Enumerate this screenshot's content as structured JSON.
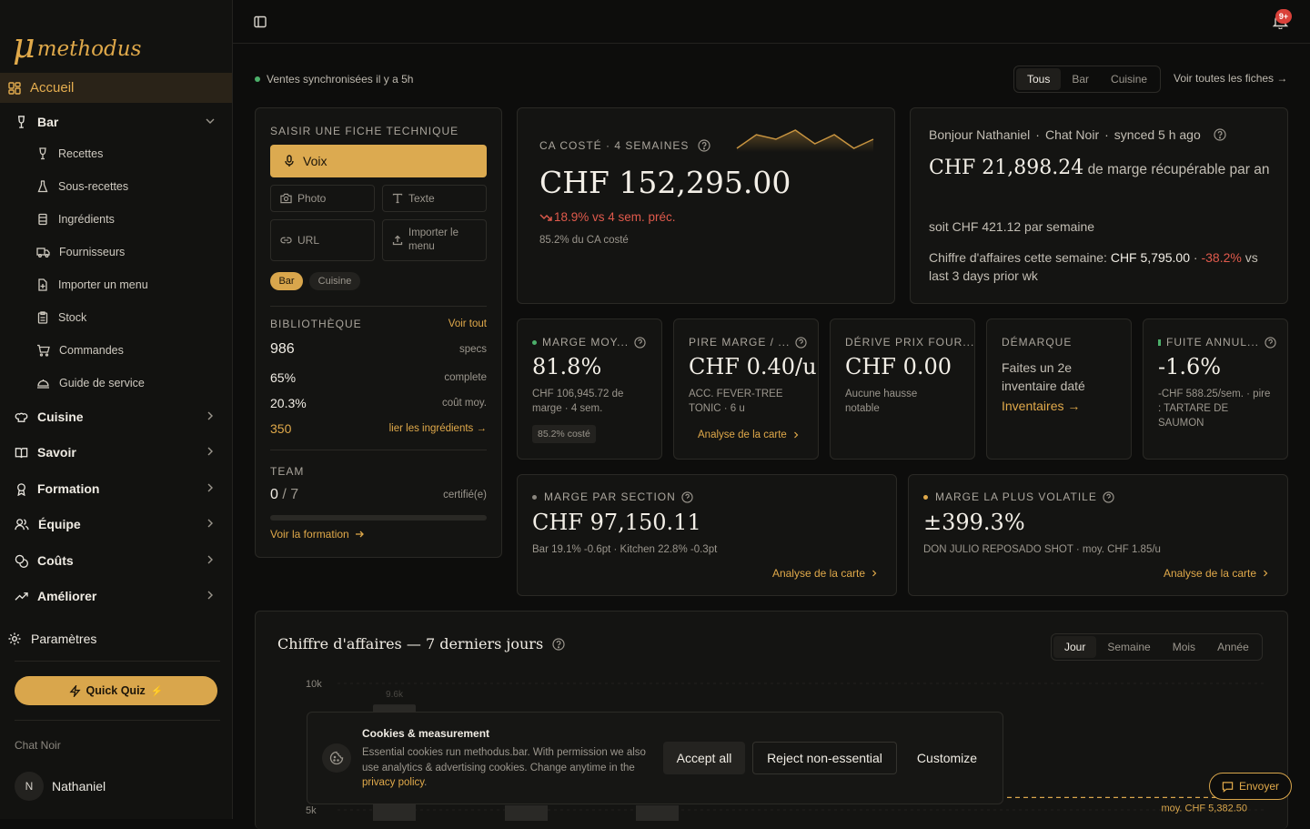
{
  "brand": {
    "mu": "μ",
    "name": "methodus"
  },
  "nav": {
    "home": "Accueil",
    "bar": {
      "label": "Bar",
      "items": [
        "Recettes",
        "Sous-recettes",
        "Ingrédients",
        "Fournisseurs",
        "Importer un menu",
        "Stock",
        "Commandes",
        "Guide de service"
      ]
    },
    "sections": [
      "Cuisine",
      "Savoir",
      "Formation",
      "Équipe",
      "Coûts",
      "Améliorer"
    ],
    "settings": "Paramètres"
  },
  "quiz": {
    "label": "Quick Quiz",
    "emoji": "⚡"
  },
  "org": "Chat Noir",
  "user": {
    "initial": "N",
    "name": "Nathaniel"
  },
  "notifications": {
    "badge": "9+"
  },
  "header": {
    "sync": "Ventes synchronisées il y a 5h",
    "filters": [
      "Tous",
      "Bar",
      "Cuisine"
    ],
    "selected_filter": "Tous",
    "all_sheets": "Voir toutes les fiches →"
  },
  "entry": {
    "title": "SAISIR UNE FICHE TECHNIQUE",
    "voice": "Voix",
    "photo": "Photo",
    "text": "Texte",
    "url": "URL",
    "import": "Importer le menu",
    "tags": [
      "Bar",
      "Cuisine"
    ],
    "library": {
      "title": "BIBLIOTHÈQUE",
      "see_all": "Voir tout",
      "rows": [
        {
          "v": "986",
          "l": "specs"
        },
        {
          "v": "65%",
          "l": "complete"
        },
        {
          "v": "20.3%",
          "l": "coût moy."
        },
        {
          "v": "350",
          "l": "lier les ingrédients →"
        }
      ]
    },
    "team": {
      "title": "TEAM",
      "done": "0",
      "sep": "/",
      "total": "7",
      "label": "certifié(e)",
      "progress": 0,
      "link": "Voir la formation"
    }
  },
  "ca": {
    "label": "CA COSTÉ · 4 SEMAINES",
    "value": "CHF 152,295.00",
    "delta": "18.9% vs 4 sem. préc.",
    "sub": "85.2% du CA costé",
    "spark": [
      6,
      9,
      8,
      10,
      7,
      9,
      6,
      8
    ]
  },
  "greeting": {
    "hello": "Bonjour Nathaniel",
    "sep1": "·",
    "org": "Chat Noir",
    "sep2": "·",
    "synced": "synced 5 h ago",
    "amount": "CHF 21,898.24",
    "amount_label": "de marge récupérable par",
    "year": "an",
    "week": "soit CHF 421.12 par semaine",
    "rev_label": "Chiffre d'affaires cette semaine:",
    "rev_value": "CHF 5,795.00",
    "rev_sep": "·",
    "rev_delta": "-38.2%",
    "rev_tail": "vs",
    "rev_tail2": "last 3 days prior wk"
  },
  "kpis": [
    {
      "label": "MARGE MOY...",
      "dot": "#4caf6a",
      "value": "81.8%",
      "sub": "CHF 106,945.72 de marge · 4 sem.",
      "chip": "85.2% costé"
    },
    {
      "label": "PIRE MARGE / ...",
      "value": "CHF 0.40/u",
      "sub": "ACC. FEVER-TREE TONIC · 6 u",
      "link": "Analyse de la carte"
    },
    {
      "label": "DÉRIVE PRIX FOUR...",
      "value": "CHF 0.00",
      "sub": "Aucune hausse notable"
    },
    {
      "label": "DÉMARQUE",
      "text": "Faites un 2e inventaire daté",
      "link": "Inventaires →"
    },
    {
      "label": "FUITE ANNUL...",
      "dot": "#4caf6a",
      "value": "-1.6%",
      "sub": "-CHF 588.25/sem. · pire : TARTARE DE SAUMON"
    }
  ],
  "section_margin": {
    "label": "MARGE PAR SECTION",
    "value": "CHF 97,150.11",
    "sub": "Bar 19.1% -0.6pt · Kitchen 22.8% -0.3pt",
    "link": "Analyse de la carte"
  },
  "volatile": {
    "label": "MARGE LA PLUS VOLATILE",
    "value": "±399.3%",
    "sub": "DON JULIO REPOSADO SHOT · moy. CHF 1.85/u",
    "link": "Analyse de la carte"
  },
  "revenue_chart": {
    "title": "Chiffre d'affaires — 7 derniers jours",
    "periods": [
      "Jour",
      "Semaine",
      "Mois",
      "Année"
    ],
    "selected_period": "Jour",
    "avg_label": "moy. CHF 5,382.50"
  },
  "chart_data": {
    "type": "bar",
    "title": "Chiffre d'affaires — 7 derniers jours",
    "yticks": [
      "10k",
      "5k"
    ],
    "ylim": [
      5000,
      10000
    ],
    "values": [
      9600
    ],
    "value_labels": [
      "9.6k"
    ],
    "average": 5382.5
  },
  "cookies": {
    "title": "Cookies & measurement",
    "text": "Essential cookies run methodus.bar. With permission we also use analytics & advertising cookies. Change anytime in the",
    "link": "privacy policy",
    "period": ".",
    "accept": "Accept all",
    "reject": "Reject non-essential",
    "customize": "Customize"
  },
  "chat": {
    "send": "Envoyer"
  }
}
